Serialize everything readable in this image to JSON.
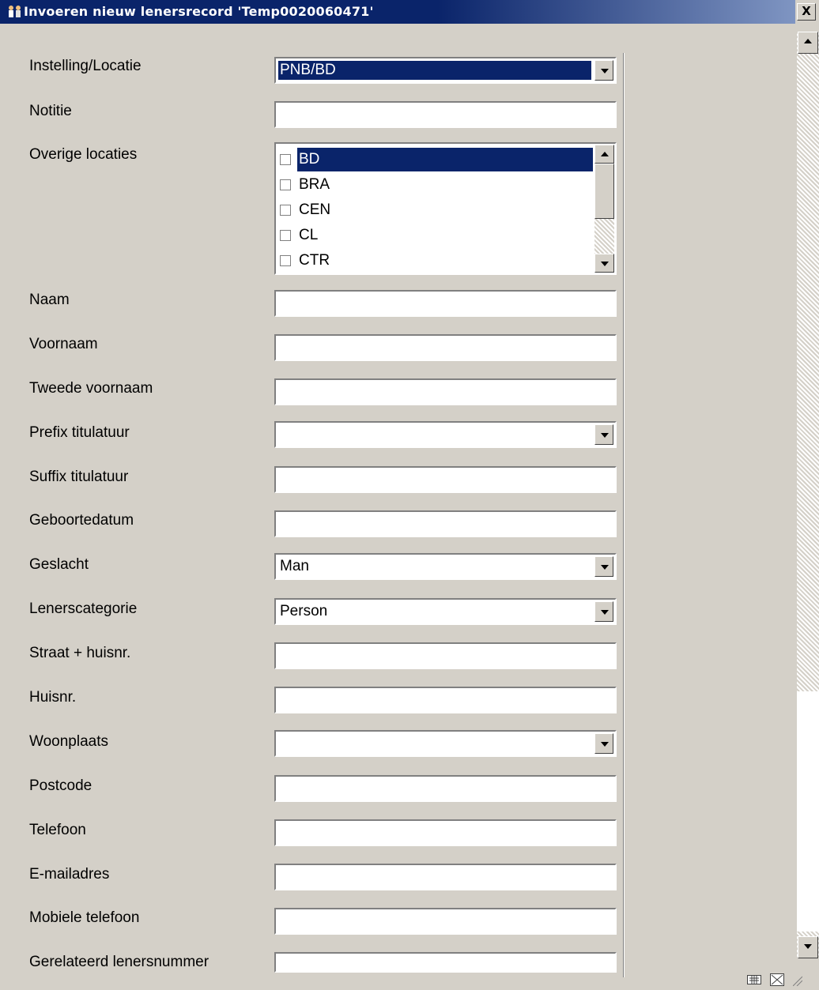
{
  "window": {
    "title": "Invoeren nieuw lenersrecord 'Temp0020060471'",
    "close_label": "X"
  },
  "form": {
    "instelling_locatie": {
      "label": "Instelling/Locatie",
      "value": "PNB/BD"
    },
    "notitie": {
      "label": "Notitie",
      "value": ""
    },
    "overige_locaties": {
      "label": "Overige locaties",
      "items": [
        {
          "label": "BD",
          "checked": false,
          "selected": true
        },
        {
          "label": "BRA",
          "checked": false,
          "selected": false
        },
        {
          "label": "CEN",
          "checked": false,
          "selected": false
        },
        {
          "label": "CL",
          "checked": false,
          "selected": false
        },
        {
          "label": "CTR",
          "checked": false,
          "selected": false
        }
      ]
    },
    "naam": {
      "label": "Naam",
      "value": ""
    },
    "voornaam": {
      "label": "Voornaam",
      "value": ""
    },
    "tweede_voornaam": {
      "label": "Tweede voornaam",
      "value": ""
    },
    "prefix_titulatuur": {
      "label": "Prefix titulatuur",
      "value": ""
    },
    "suffix_titulatuur": {
      "label": "Suffix titulatuur",
      "value": ""
    },
    "geboortedatum": {
      "label": "Geboortedatum",
      "value": ""
    },
    "geslacht": {
      "label": "Geslacht",
      "value": "Man"
    },
    "lenerscategorie": {
      "label": "Lenerscategorie",
      "value": "Person"
    },
    "straat": {
      "label": "Straat + huisnr.",
      "value": ""
    },
    "huisnr": {
      "label": "Huisnr.",
      "value": ""
    },
    "woonplaats": {
      "label": "Woonplaats",
      "value": ""
    },
    "postcode": {
      "label": "Postcode",
      "value": ""
    },
    "telefoon": {
      "label": "Telefoon",
      "value": ""
    },
    "emailadres": {
      "label": "E-mailadres",
      "value": ""
    },
    "mobiele_telefoon": {
      "label": "Mobiele telefoon",
      "value": ""
    },
    "gerelateerd_lenersnummer": {
      "label": "Gerelateerd lenersnummer",
      "value": ""
    }
  },
  "colors": {
    "titlebar": "#0a246a",
    "selection": "#0a246a",
    "face": "#d4d0c8"
  }
}
